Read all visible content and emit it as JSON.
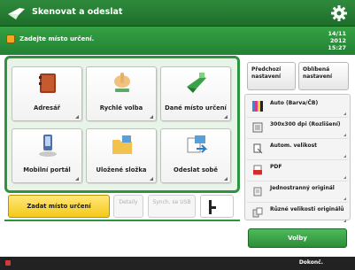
{
  "header": {
    "title": "Skenovat a odeslat"
  },
  "status": {
    "message": "Zadejte místo určení.",
    "date": "14/11 2012",
    "time": "15:27"
  },
  "destinations": [
    {
      "label": "Adresář",
      "icon": "address-book-icon"
    },
    {
      "label": "Rychlé volba",
      "icon": "one-touch-icon"
    },
    {
      "label": "Dané místo určení",
      "icon": "favorites-icon"
    },
    {
      "label": "Mobilní portál",
      "icon": "mobile-portal-icon"
    },
    {
      "label": "Uložené složka",
      "icon": "folder-icon"
    },
    {
      "label": "Odeslat sobě",
      "icon": "send-to-myself-icon"
    }
  ],
  "bottom": {
    "confirm": "Zadat místo určení",
    "details": "Detaily",
    "sync": "Synch. se USB"
  },
  "tabs": {
    "previous": "Předchozí nastavení",
    "favorite": "Oblíbená nastavení"
  },
  "settings": [
    {
      "label": "Auto (Barva/ČB)",
      "icon": "color-mode-icon"
    },
    {
      "label": "300x300 dpi (Rozlišení)",
      "icon": "resolution-icon"
    },
    {
      "label": "Autom. velikost",
      "icon": "scan-size-icon"
    },
    {
      "label": "PDF",
      "icon": "file-format-icon"
    },
    {
      "label": "Jednostranný originál",
      "icon": "original-type-icon"
    },
    {
      "label": "Různé velikosti originálů",
      "icon": "mixed-size-icon"
    }
  ],
  "options": "Volby",
  "footer": {
    "monitor": "Dokonč."
  },
  "colors": {
    "brand_green": "#2f9440",
    "accent_yellow": "#f5c918"
  }
}
